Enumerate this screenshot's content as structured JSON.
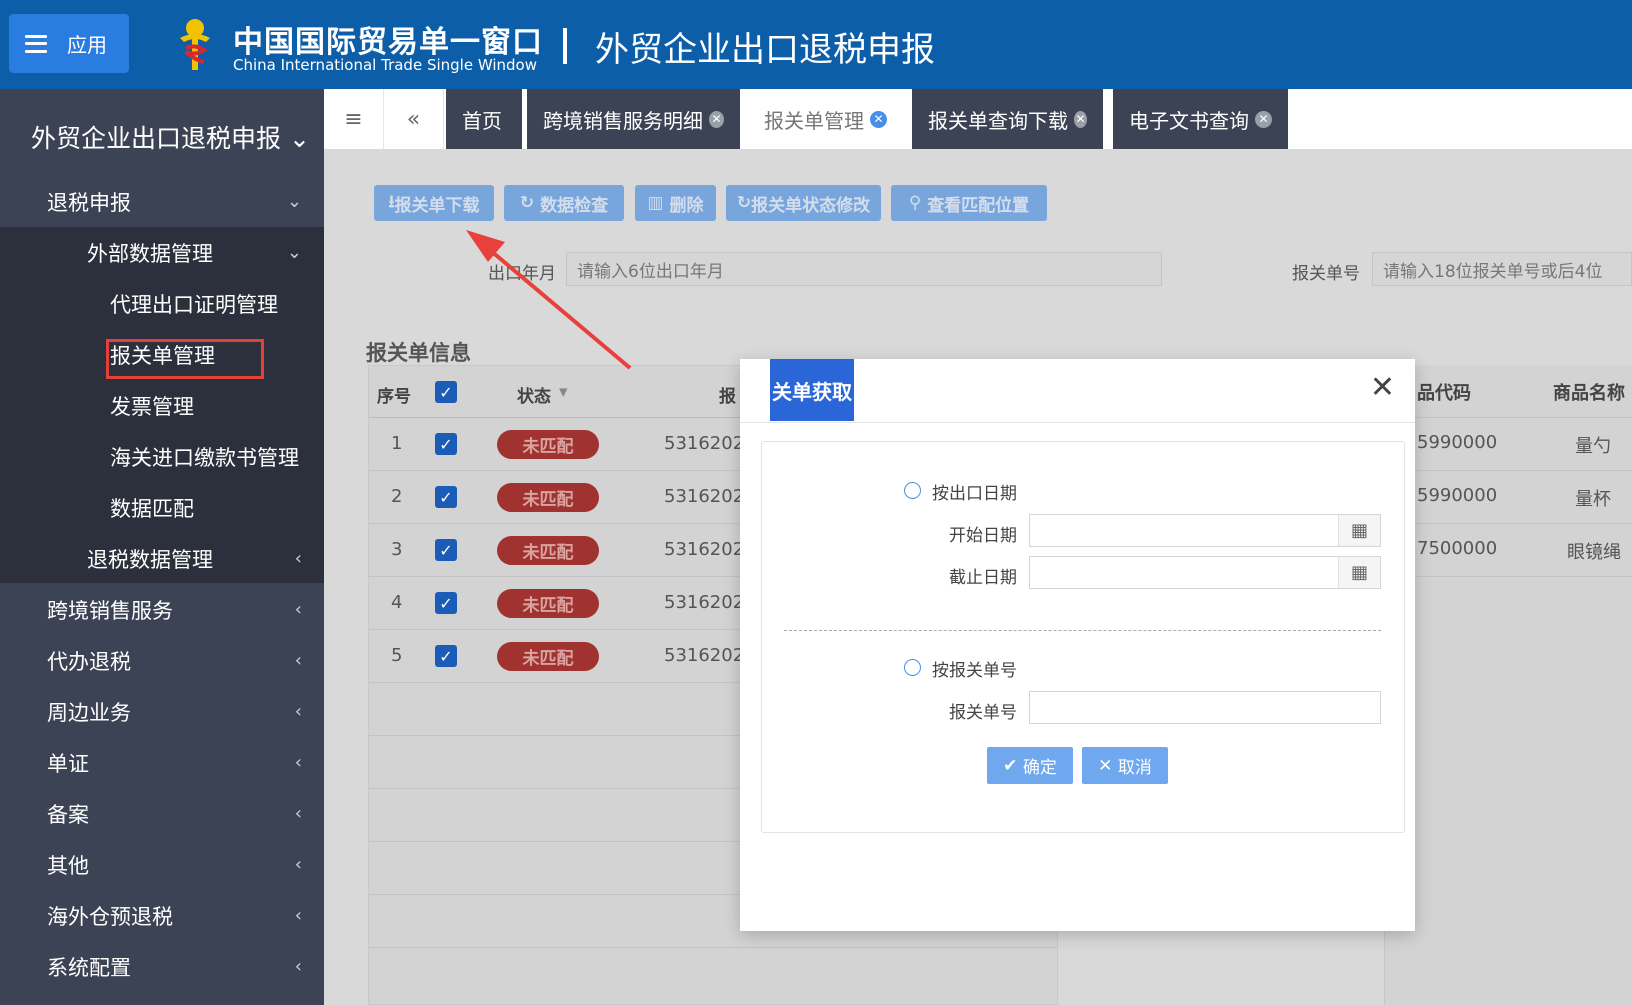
{
  "header": {
    "app_button": "应用",
    "brand_cn": "中国国际贸易单一窗口",
    "brand_en": "China International Trade Single Window",
    "title": "外贸企业出口退税申报"
  },
  "sidebar": {
    "title": "外贸企业出口退税申报",
    "items": [
      {
        "label": "退税申报"
      },
      {
        "label": "外部数据管理"
      },
      {
        "label": "代理出口证明管理"
      },
      {
        "label": "报关单管理"
      },
      {
        "label": "发票管理"
      },
      {
        "label": "海关进口缴款书管理"
      },
      {
        "label": "数据匹配"
      },
      {
        "label": "退税数据管理"
      },
      {
        "label": "跨境销售服务"
      },
      {
        "label": "代办退税"
      },
      {
        "label": "周边业务"
      },
      {
        "label": "单证"
      },
      {
        "label": "备案"
      },
      {
        "label": "其他"
      },
      {
        "label": "海外仓预退税"
      },
      {
        "label": "系统配置"
      }
    ]
  },
  "tabs": [
    {
      "label": "首页"
    },
    {
      "label": "跨境销售服务明细"
    },
    {
      "label": "报关单管理"
    },
    {
      "label": "报关单查询下载"
    },
    {
      "label": "电子文书查询"
    }
  ],
  "toolbar": {
    "download": "报关单下载",
    "check": "数据检查",
    "delete": "删除",
    "status_edit": "报关单状态修改",
    "view_match": "查看匹配位置"
  },
  "filters": {
    "export_month_label": "出口年月",
    "export_month_placeholder": "请输入6位出口年月",
    "decl_no_label": "报关单号",
    "decl_no_placeholder": "请输入18位报关单号或后4位"
  },
  "section_title": "报关单信息",
  "grid": {
    "headers": {
      "seq": "序号",
      "status": "状态",
      "decl": "报"
    },
    "rows": [
      {
        "seq": "1",
        "status": "未匹配",
        "decl": "5316202"
      },
      {
        "seq": "2",
        "status": "未匹配",
        "decl": "5316202"
      },
      {
        "seq": "3",
        "status": "未匹配",
        "decl": "5316202"
      },
      {
        "seq": "4",
        "status": "未匹配",
        "decl": "5316202"
      },
      {
        "seq": "5",
        "status": "未匹配",
        "decl": "5316202"
      }
    ]
  },
  "grid2": {
    "headers": {
      "code": "品代码",
      "name": "商品名称"
    },
    "rows": [
      {
        "code": "5990000",
        "name": "量勺"
      },
      {
        "code": "5990000",
        "name": "量杯"
      },
      {
        "code": "7500000",
        "name": "眼镜绳"
      }
    ]
  },
  "modal": {
    "title": "关单获取",
    "option_date": "按出口日期",
    "start_label": "开始日期",
    "end_label": "截止日期",
    "option_no": "按报关单号",
    "no_label": "报关单号",
    "ok": "确定",
    "cancel": "取消"
  }
}
